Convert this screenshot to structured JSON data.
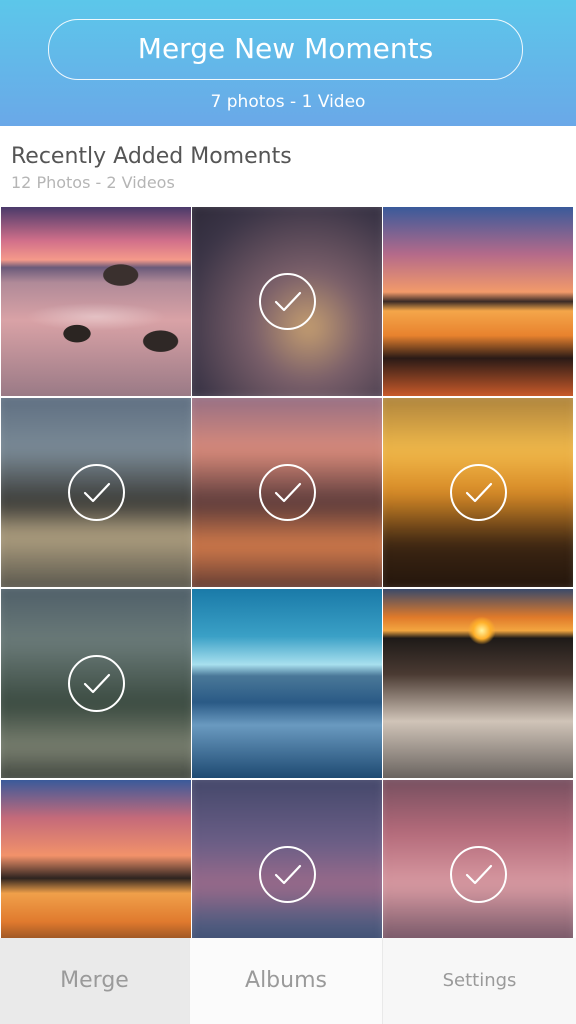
{
  "header": {
    "merge_button_label": "Merge New Moments",
    "subtitle": "7 photos - 1 Video"
  },
  "section": {
    "title": "Recently Added Moments",
    "subtitle": "12 Photos - 2 Videos"
  },
  "photos": [
    {
      "scene": "rocky-beach-sunset",
      "selected": false
    },
    {
      "scene": "palm-silhouette-dusk",
      "selected": true
    },
    {
      "scene": "tree-reflection-lake",
      "selected": false
    },
    {
      "scene": "blurred-blue-horizon",
      "selected": true
    },
    {
      "scene": "blurred-pink-sunset",
      "selected": true
    },
    {
      "scene": "blurred-golden-sunset",
      "selected": true
    },
    {
      "scene": "blurred-green-landscape",
      "selected": true
    },
    {
      "scene": "icy-blue-terrain",
      "selected": false
    },
    {
      "scene": "ocean-sunset-waves",
      "selected": false
    },
    {
      "scene": "tree-reflection-lake-2",
      "selected": false
    },
    {
      "scene": "blurred-purple-dusk",
      "selected": true
    },
    {
      "scene": "blurred-pink-sea",
      "selected": true
    }
  ],
  "tabs": {
    "merge": "Merge",
    "albums": "Albums",
    "settings": "Settings",
    "active": "merge"
  },
  "colors": {
    "header_top": "#5cc7ea",
    "header_bottom": "#6aa8e8"
  }
}
